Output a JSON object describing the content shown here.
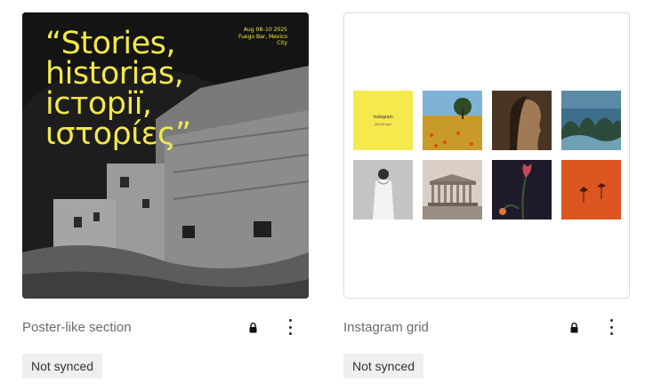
{
  "cards": [
    {
      "title": "Poster-like section",
      "status": "Not synced",
      "preview": {
        "quote": "“Stories,\nhistorias,\nісторії,\nιστορίες”",
        "event_lines": [
          "Aug 08–10 2025",
          "Fuego Bar, Mexico",
          "City"
        ],
        "accent": "#f2e84a"
      },
      "icons": [
        "lock-icon",
        "more-vertical-icon"
      ]
    },
    {
      "title": "Instagram grid",
      "status": "Not synced",
      "preview": {
        "brand_tile": {
          "title": "Instagram",
          "handle": "@example"
        },
        "accent": "#f5e94d"
      },
      "icons": [
        "lock-icon",
        "more-vertical-icon"
      ]
    }
  ]
}
